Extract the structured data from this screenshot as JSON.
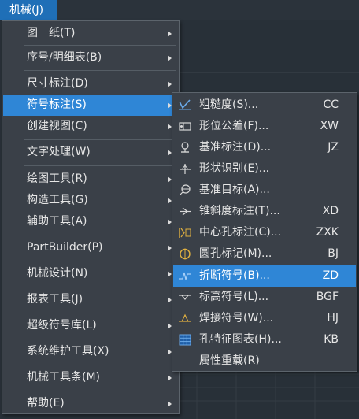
{
  "menubar": {
    "title": "机械(J)"
  },
  "main_menu": {
    "items": [
      {
        "label": "图　纸(T)",
        "has_submenu": true
      },
      {
        "label": "序号/明细表(B)",
        "has_submenu": true
      },
      {
        "label": "尺寸标注(D)",
        "has_submenu": true
      },
      {
        "label": "符号标注(S)",
        "has_submenu": true,
        "highlighted": true
      },
      {
        "label": "创建视图(C)",
        "has_submenu": true
      },
      {
        "label": "文字处理(W)",
        "has_submenu": true
      },
      {
        "label": "绘图工具(R)",
        "has_submenu": true
      },
      {
        "label": "构造工具(G)",
        "has_submenu": true
      },
      {
        "label": "辅助工具(A)",
        "has_submenu": true
      },
      {
        "label": "PartBuilder(P)",
        "has_submenu": true
      },
      {
        "label": "机械设计(N)",
        "has_submenu": true
      },
      {
        "label": "报表工具(J)",
        "has_submenu": true
      },
      {
        "label": "超级符号库(L)",
        "has_submenu": true
      },
      {
        "label": "系统维护工具(X)",
        "has_submenu": true
      },
      {
        "label": "机械工具条(M)",
        "has_submenu": true
      },
      {
        "label": "帮助(E)",
        "has_submenu": true
      }
    ]
  },
  "sub_menu": {
    "items": [
      {
        "label": "粗糙度(S)...",
        "shortcut": "CC",
        "icon": "roughness-icon"
      },
      {
        "label": "形位公差(F)...",
        "shortcut": "XW",
        "icon": "tolerance-icon"
      },
      {
        "label": "基准标注(D)...",
        "shortcut": "JZ",
        "icon": "datum-icon"
      },
      {
        "label": "形状识别(E)...",
        "shortcut": "",
        "icon": "shape-recognition-icon"
      },
      {
        "label": "基准目标(A)...",
        "shortcut": "",
        "icon": "datum-target-icon"
      },
      {
        "label": "锥斜度标注(T)...",
        "shortcut": "XD",
        "icon": "taper-icon"
      },
      {
        "label": "中心孔标注(C)...",
        "shortcut": "ZXK",
        "icon": "center-hole-icon"
      },
      {
        "label": "圆孔标记(M)...",
        "shortcut": "BJ",
        "icon": "hole-mark-icon"
      },
      {
        "label": "折断符号(B)...",
        "shortcut": "ZD",
        "icon": "break-symbol-icon",
        "highlighted": true
      },
      {
        "label": "标高符号(L)...",
        "shortcut": "BGF",
        "icon": "elevation-icon"
      },
      {
        "label": "焊接符号(W)...",
        "shortcut": "HJ",
        "icon": "weld-icon"
      },
      {
        "label": "孔特征图表(H)...",
        "shortcut": "KB",
        "icon": "hole-table-icon"
      },
      {
        "label": "属性重载(R)",
        "shortcut": "",
        "icon": ""
      }
    ]
  },
  "colors": {
    "menu_bg": "#3a4048",
    "highlight": "#2f86d6",
    "menubar_active": "#1f6fb7",
    "text": "#e6e6e6"
  }
}
